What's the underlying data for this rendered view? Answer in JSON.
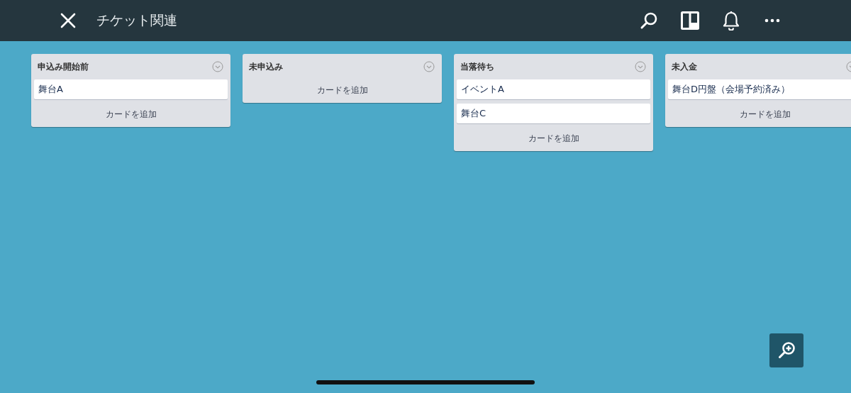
{
  "header": {
    "title": "チケット関連"
  },
  "lists": [
    {
      "title": "申込み開始前",
      "cards": [
        "舞台A"
      ],
      "add_label": "カードを追加"
    },
    {
      "title": "未申込み",
      "add_label": "カードを追加"
    },
    {
      "title": "当落待ち",
      "cards": [
        "イベントA",
        "舞台C"
      ],
      "add_label": "カードを追加"
    },
    {
      "title": "未入金",
      "cards": [
        "舞台D円盤（会場予約済み）"
      ],
      "add_label": "カードを追加"
    }
  ]
}
